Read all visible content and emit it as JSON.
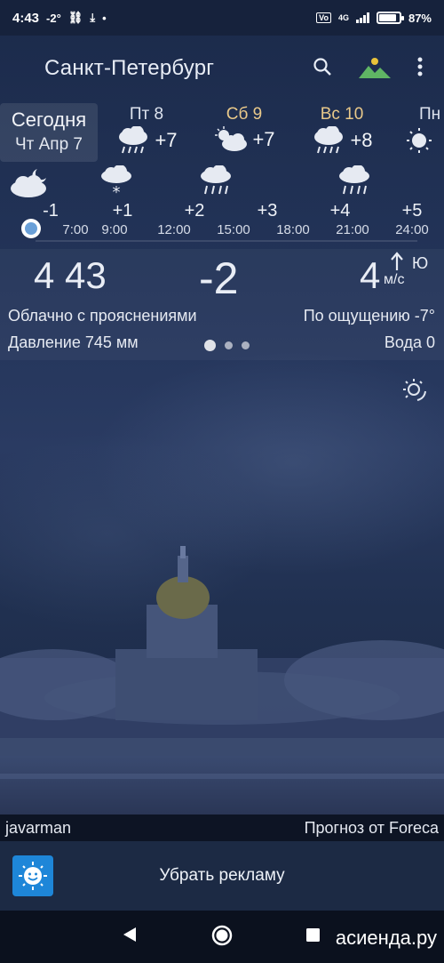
{
  "status_bar": {
    "time": "4:43",
    "temp_indicator": "-2°",
    "network": "4G",
    "battery_percent": "87%",
    "battery_level": 0.87
  },
  "toolbar": {
    "city": "Санкт-Петербург"
  },
  "days": {
    "today": {
      "name": "Сегодня",
      "date": "Чт Апр 7"
    },
    "items": [
      {
        "name": "Пт 8",
        "temp": "+7",
        "icon": "rain-cloud-icon"
      },
      {
        "name": "Сб 9",
        "temp": "+7",
        "icon": "partly-cloudy-icon"
      },
      {
        "name": "Вс 10",
        "temp": "+8",
        "icon": "rain-cloud-icon"
      },
      {
        "name": "Пн",
        "temp": "",
        "icon": "sun-icon"
      }
    ]
  },
  "hourly": {
    "temps": [
      "-1",
      "+1",
      "+2",
      "+3",
      "+4",
      "+5"
    ],
    "times": [
      "7:00",
      "9:00",
      "12:00",
      "15:00",
      "18:00",
      "21:00",
      "24:00"
    ],
    "icons": [
      "cloudy-night-icon",
      "snow-cloud-icon",
      "rain-cloud-icon",
      "rain-cloud-icon"
    ]
  },
  "current": {
    "time": "4 43",
    "temperature": "-2",
    "wind_speed": "4",
    "wind_unit": "м/с",
    "wind_direction": "Ю",
    "condition": "Облачно с прояснениями",
    "feels_like": "По ощущению -7°",
    "pressure": "Давление 745 мм",
    "water": "Вода 0"
  },
  "credits": {
    "author": "javarman",
    "provider": "Прогноз от Foreca"
  },
  "ad": {
    "label": "Убрать рекламу"
  },
  "watermark": "асиенда.ру"
}
